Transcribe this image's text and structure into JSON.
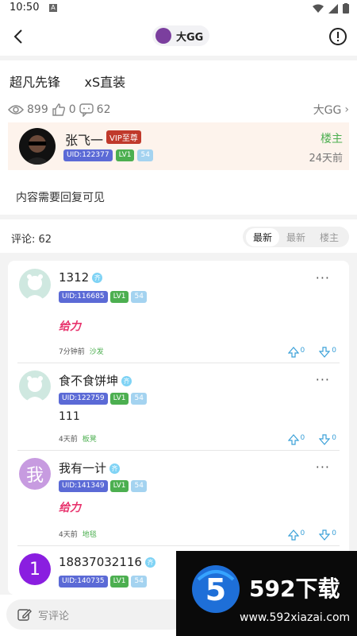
{
  "statusbar": {
    "time": "10:50",
    "a_icon": "A"
  },
  "header": {
    "title": "大GG"
  },
  "post": {
    "title": "超凡先锋      xS直装",
    "views": "899",
    "likes": "0",
    "comments": "62",
    "board": "大GG",
    "content": "内容需要回复可见"
  },
  "author": {
    "name": "张飞一",
    "vip": "VIP至尊",
    "uid": "UID:122377",
    "level": "LV1",
    "num": "54",
    "role": "楼主",
    "time": "24天前"
  },
  "comments_header": {
    "count_label": "评论: 62",
    "sort": [
      "最新",
      "最新",
      "楼主"
    ]
  },
  "comments": [
    {
      "name": "1312",
      "qi": "齐",
      "uid": "UID:116685",
      "level": "LV1",
      "num": "54",
      "body": "给力",
      "time": "7分钟前",
      "tag": "沙发",
      "up": "0",
      "down": "0"
    },
    {
      "name": "食不食饼坤",
      "qi": "齐",
      "uid": "UID:122759",
      "level": "LV1",
      "num": "54",
      "body": "111",
      "time": "4天前",
      "tag": "板凳",
      "up": "0",
      "down": "0"
    },
    {
      "name": "我有一计",
      "qi": "齐",
      "uid": "UID:141349",
      "level": "LV1",
      "num": "54",
      "body": "给力",
      "time": "4天前",
      "tag": "地毯",
      "up": "0",
      "down": "0",
      "avatar_char": "我"
    },
    {
      "name": "18837032116",
      "qi": "齐",
      "uid": "UID:140735",
      "level": "LV1",
      "num": "54",
      "avatar_char": "1"
    }
  ],
  "bottom": {
    "write_placeholder": "写评论"
  },
  "watermark": {
    "title": "592下载",
    "url": "www.592xiazai.com",
    "logo": "5"
  },
  "colors": {
    "accent_green": "#4caf50",
    "uid_blue": "#5b6ad6",
    "vip_red": "#c0392b",
    "vote_blue": "#3aa0d8"
  }
}
